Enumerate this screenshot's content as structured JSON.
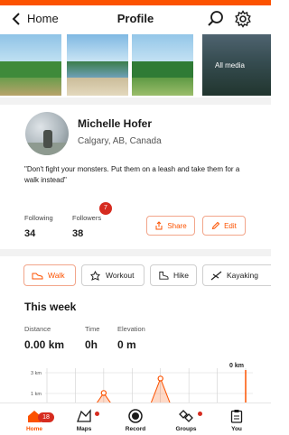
{
  "colors": {
    "accent": "#fc5200",
    "badge": "#d62b1f"
  },
  "header": {
    "back_label": "Home",
    "title": "Profile",
    "search_icon": "search-icon",
    "settings_icon": "gear-icon"
  },
  "media": {
    "all_media_label": "All media"
  },
  "profile": {
    "name": "Michelle Hofer",
    "location": "Calgary, AB, Canada",
    "bio": "\"Don't fight your monsters. Put them on a leash and take them for a walk instead\"",
    "following_label": "Following",
    "following_count": "34",
    "followers_label": "Followers",
    "followers_count": "38",
    "followers_badge": "7",
    "share_label": "Share",
    "edit_label": "Edit"
  },
  "activity_types": [
    {
      "label": "Walk",
      "icon": "shoe-icon",
      "active": true
    },
    {
      "label": "Workout",
      "icon": "workout-icon",
      "active": false
    },
    {
      "label": "Hike",
      "icon": "hiking-boot-icon",
      "active": false
    },
    {
      "label": "Kayaking",
      "icon": "kayak-icon",
      "active": false
    }
  ],
  "week": {
    "title": "This week",
    "distance_label": "Distance",
    "distance_value": "0.00 km",
    "time_label": "Time",
    "time_value": "0h",
    "elevation_label": "Elevation",
    "elevation_value": "0 m"
  },
  "chart_data": {
    "type": "area",
    "y_ticks": [
      "3 km",
      "1 km"
    ],
    "current_label": "0 km",
    "values": [
      0,
      0,
      1.8,
      0,
      3.2,
      0,
      0,
      0
    ],
    "ylim": [
      0,
      3.5
    ]
  },
  "nav": {
    "home_label": "Home",
    "home_badge": "18",
    "maps_label": "Maps",
    "record_label": "Record",
    "groups_label": "Groups",
    "you_label": "You"
  }
}
